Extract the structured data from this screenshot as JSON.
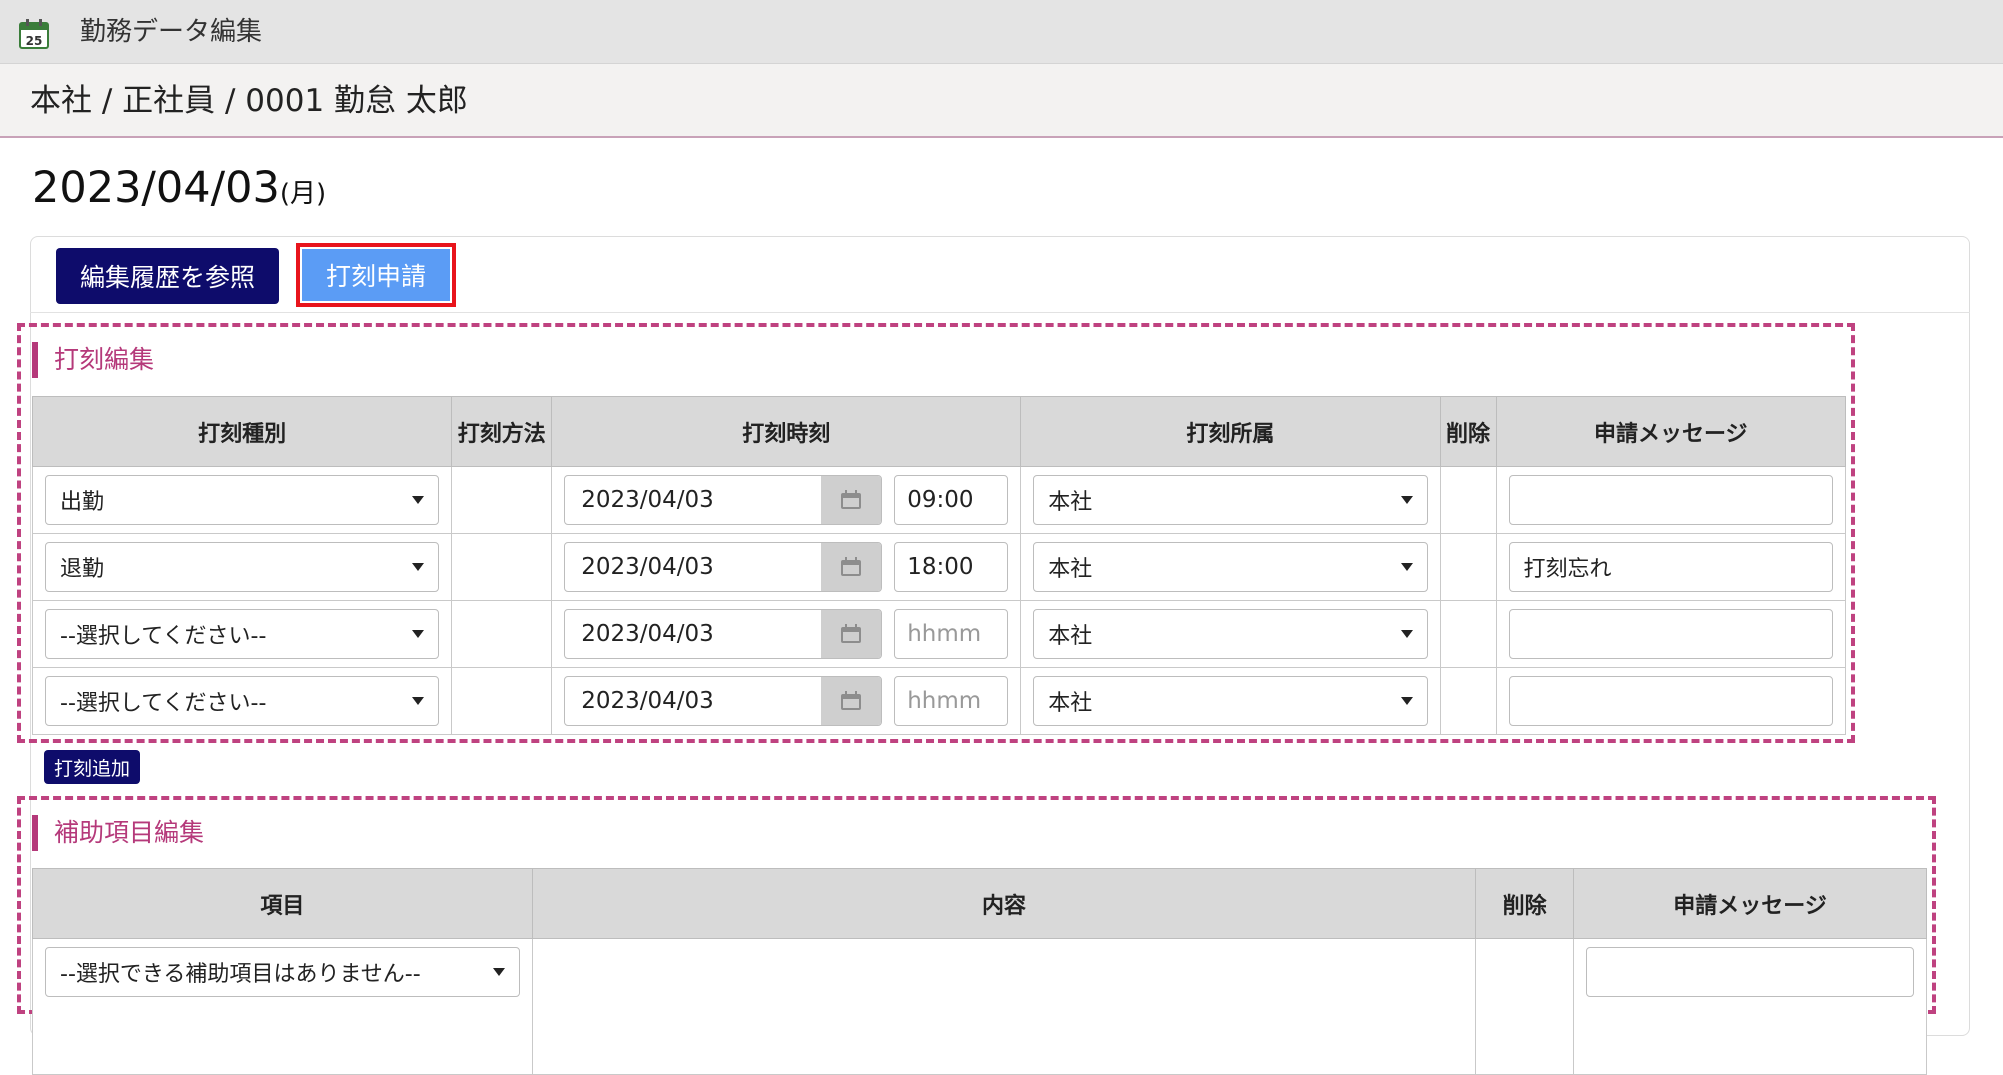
{
  "window": {
    "title": "勤務データ編集",
    "icon": "calendar-icon",
    "icon_day": "25"
  },
  "breadcrumb": "本社 / 正社員 / 0001 勤怠 太郎",
  "date": {
    "value": "2023/04/03",
    "weekday": "(月)"
  },
  "toolbar": {
    "history_label": "編集履歴を参照",
    "apply_label": "打刻申請"
  },
  "punch_section": {
    "title": "打刻編集",
    "headers": {
      "type": "打刻種別",
      "method": "打刻方法",
      "time": "打刻時刻",
      "affiliation": "打刻所属",
      "delete": "削除",
      "message": "申請メッセージ"
    },
    "rows": [
      {
        "type": "出勤",
        "method": "",
        "date": "2023/04/03",
        "time": "09:00",
        "time_placeholder": "hhmm",
        "affiliation": "本社",
        "delete": "",
        "message": ""
      },
      {
        "type": "退勤",
        "method": "",
        "date": "2023/04/03",
        "time": "18:00",
        "time_placeholder": "hhmm",
        "affiliation": "本社",
        "delete": "",
        "message": "打刻忘れ"
      },
      {
        "type": "--選択してください--",
        "method": "",
        "date": "2023/04/03",
        "time": "",
        "time_placeholder": "hhmm",
        "affiliation": "本社",
        "delete": "",
        "message": ""
      },
      {
        "type": "--選択してください--",
        "method": "",
        "date": "2023/04/03",
        "time": "",
        "time_placeholder": "hhmm",
        "affiliation": "本社",
        "delete": "",
        "message": ""
      }
    ],
    "add_label": "打刻追加"
  },
  "aux_section": {
    "title": "補助項目編集",
    "headers": {
      "item": "項目",
      "content": "内容",
      "delete": "削除",
      "message": "申請メッセージ"
    },
    "rows": [
      {
        "item": "--選択できる補助項目はありません--",
        "content": "",
        "delete": "",
        "message": ""
      }
    ]
  },
  "colors": {
    "accent_navy": "#0e0c6b",
    "apply_blue": "#5b9cf5",
    "highlight_red": "#e8141c",
    "section_magenta": "#b5397a",
    "dashed_border": "#bf4280"
  }
}
